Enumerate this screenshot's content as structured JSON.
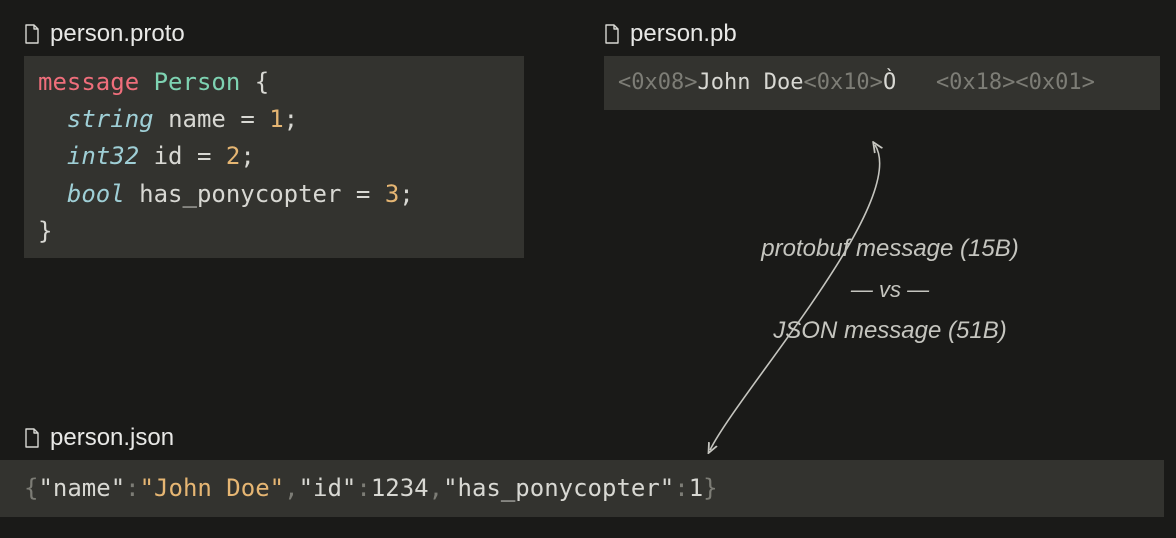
{
  "files": {
    "proto": {
      "name": "person.proto",
      "code": {
        "kw_message": "message",
        "type_person": "Person",
        "brace_open": "{",
        "f1_type": "string",
        "f1_name": "name",
        "f1_eq": "=",
        "f1_num": "1",
        "f2_type": "int32",
        "f2_name": "id",
        "f2_eq": "=",
        "f2_num": "2",
        "f3_type": "bool",
        "f3_name": "has_ponycopter",
        "f3_eq": "=",
        "f3_num": "3",
        "semi": ";",
        "brace_close": "}"
      }
    },
    "pb": {
      "name": "person.pb",
      "bytes": {
        "h1": "<0x08>",
        "name": "John Doe",
        "h2": "<0x10>",
        "raw": "Ò",
        "gap": "   ",
        "h3": "<0x18>",
        "h4": "<0x01>"
      }
    },
    "json": {
      "name": "person.json",
      "content": {
        "open": "{",
        "k1": "\"name\"",
        "colon": ":",
        "v1": "\"John Doe\"",
        "comma": ",",
        "k2": "\"id\"",
        "v2": "1234",
        "k3": "\"has_ponycopter\"",
        "v3": "1",
        "close": "}"
      }
    }
  },
  "compare": {
    "line1": "protobuf message (15B)",
    "vs": "— vs —",
    "line2": "JSON message (51B)"
  }
}
